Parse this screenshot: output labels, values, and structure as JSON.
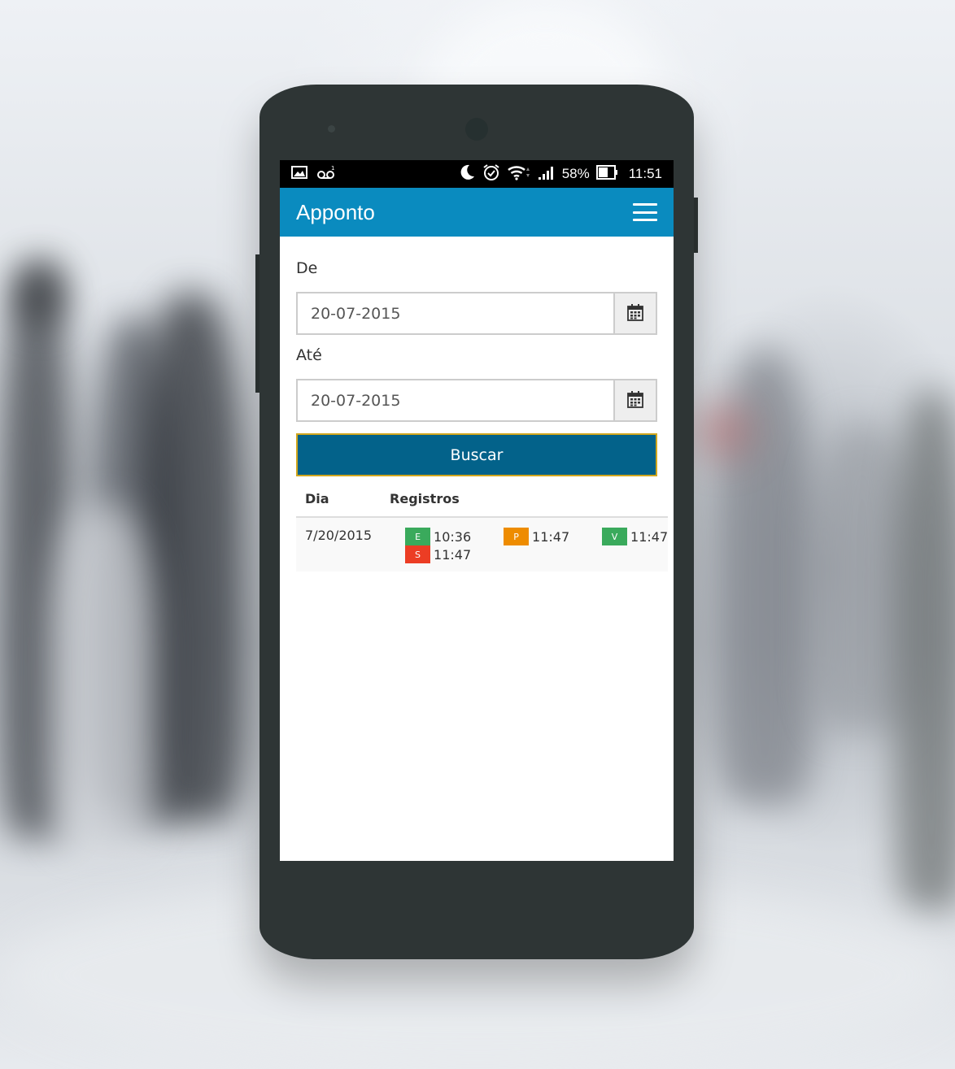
{
  "status_bar": {
    "battery": "58%",
    "time": "11:51",
    "icons": [
      "gallery-icon",
      "voicemail-icon",
      "moon-icon",
      "alarm-icon",
      "wifi-icon",
      "signal-icon",
      "battery-icon"
    ]
  },
  "app_bar": {
    "title": "Apponto",
    "menu_icon": "hamburger-menu-icon"
  },
  "form": {
    "from_label": "De",
    "from_value": "20-07-2015",
    "to_label": "Até",
    "to_value": "20-07-2015",
    "calendar_icon": "calendar-icon",
    "search_label": "Buscar"
  },
  "table": {
    "headers": [
      "Dia",
      "Registros"
    ],
    "rows": [
      {
        "day": "7/20/2015",
        "records": [
          {
            "tag": "E",
            "time": "10:36",
            "color": "#3aaa5c"
          },
          {
            "tag": "S",
            "time": "11:47",
            "color": "#ec3d24"
          },
          {
            "tag": "P",
            "time": "11:47",
            "color": "#ee8c00"
          },
          {
            "tag": "V",
            "time": "11:47",
            "color": "#3aaa5c"
          }
        ]
      }
    ]
  },
  "colors": {
    "app_bar": "#0a8bbf",
    "button": "#03628a",
    "button_border": "#d1a61d"
  }
}
